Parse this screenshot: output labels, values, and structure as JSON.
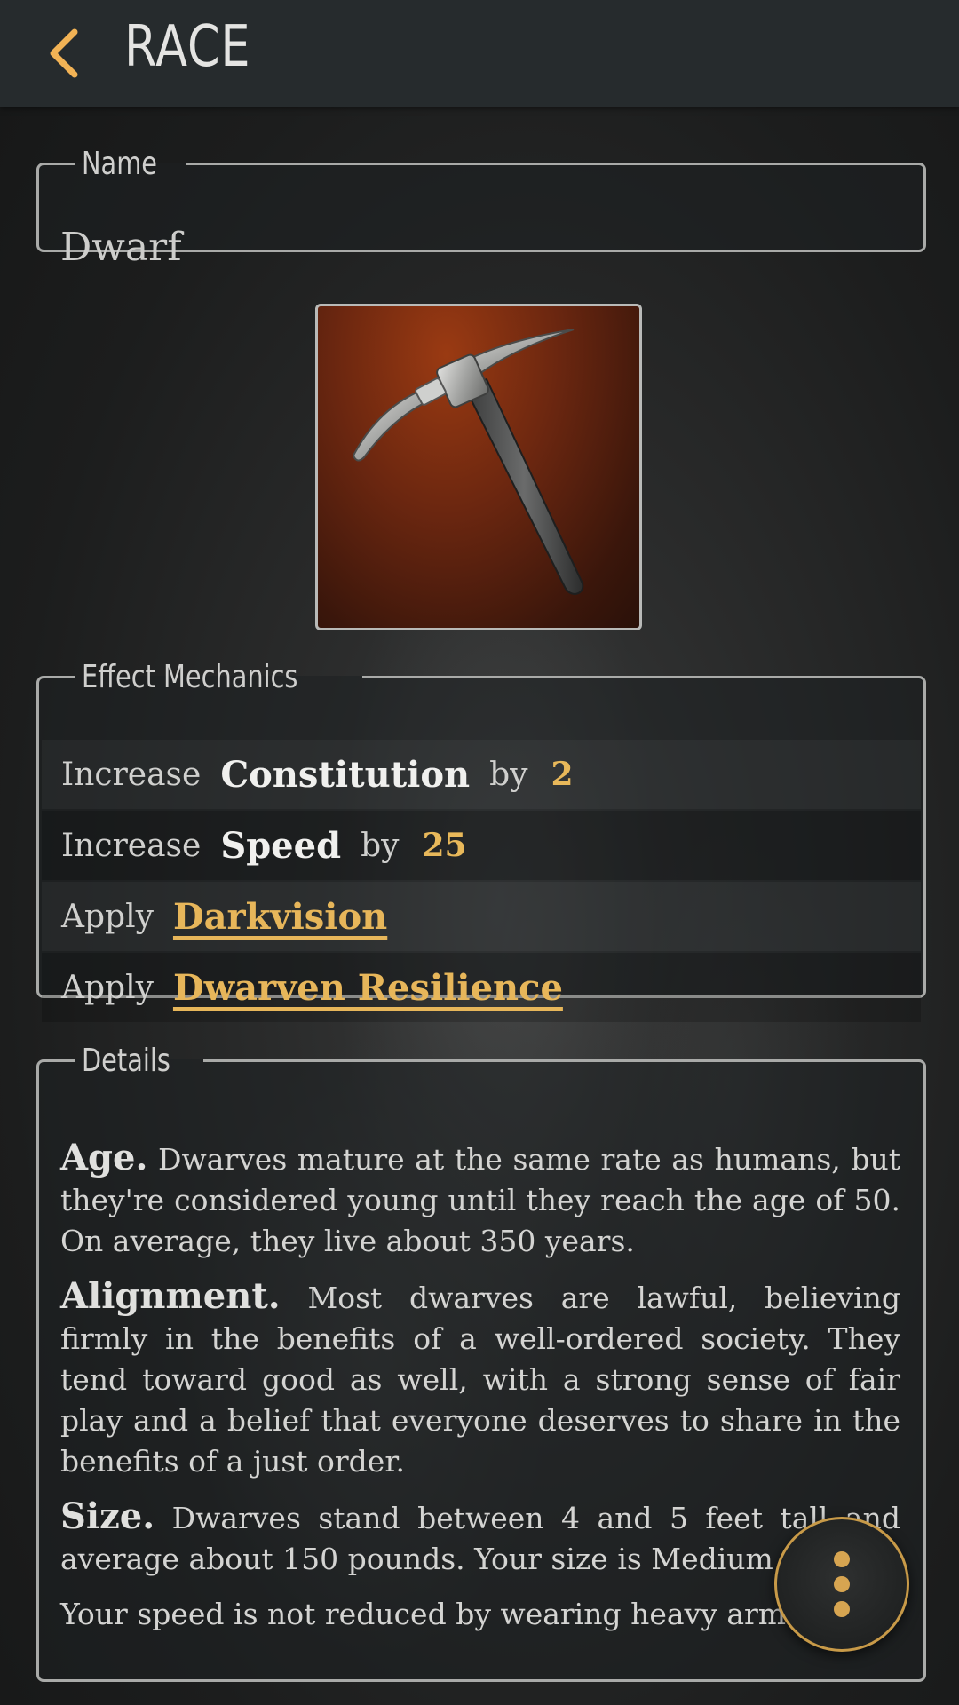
{
  "header": {
    "title": "RACE",
    "back_icon": "chevron-left-icon",
    "accent": "#f2b355"
  },
  "name_field": {
    "label": "Name",
    "value": "Dwarf"
  },
  "portrait": {
    "icon": "pickaxe-icon"
  },
  "effect_mechanics": {
    "label": "Effect Mechanics",
    "rows": [
      {
        "verb": "Increase",
        "attribute": "Constitution",
        "by": "by",
        "amount": "2"
      },
      {
        "verb": "Increase",
        "attribute": "Speed",
        "by": "by",
        "amount": "25"
      },
      {
        "verb": "Apply",
        "link": "Darkvision"
      },
      {
        "verb": "Apply",
        "link": "Dwarven Resilience"
      }
    ]
  },
  "details": {
    "label": "Details",
    "paragraphs": [
      {
        "heading": "Age.",
        "text": " Dwarves mature at the same rate as humans, but they're considered young until they reach the age of 50. On average, they live about 350 years."
      },
      {
        "heading": "Alignment.",
        "text": " Most dwarves are lawful, believing firmly in the benefits of a well-ordered society. They tend toward good as well, with a strong sense of fair play and a belief that everyone deserves to share in the benefits of a just order."
      },
      {
        "heading": "Size.",
        "text": " Dwarves stand between 4 and 5 feet tall and average about 150 pounds. Your size is Medium"
      },
      {
        "heading": "",
        "text": "Your speed is not reduced by wearing heavy armor."
      }
    ]
  },
  "fab": {
    "icon": "more-vertical-icon",
    "accent": "#d7a551"
  }
}
